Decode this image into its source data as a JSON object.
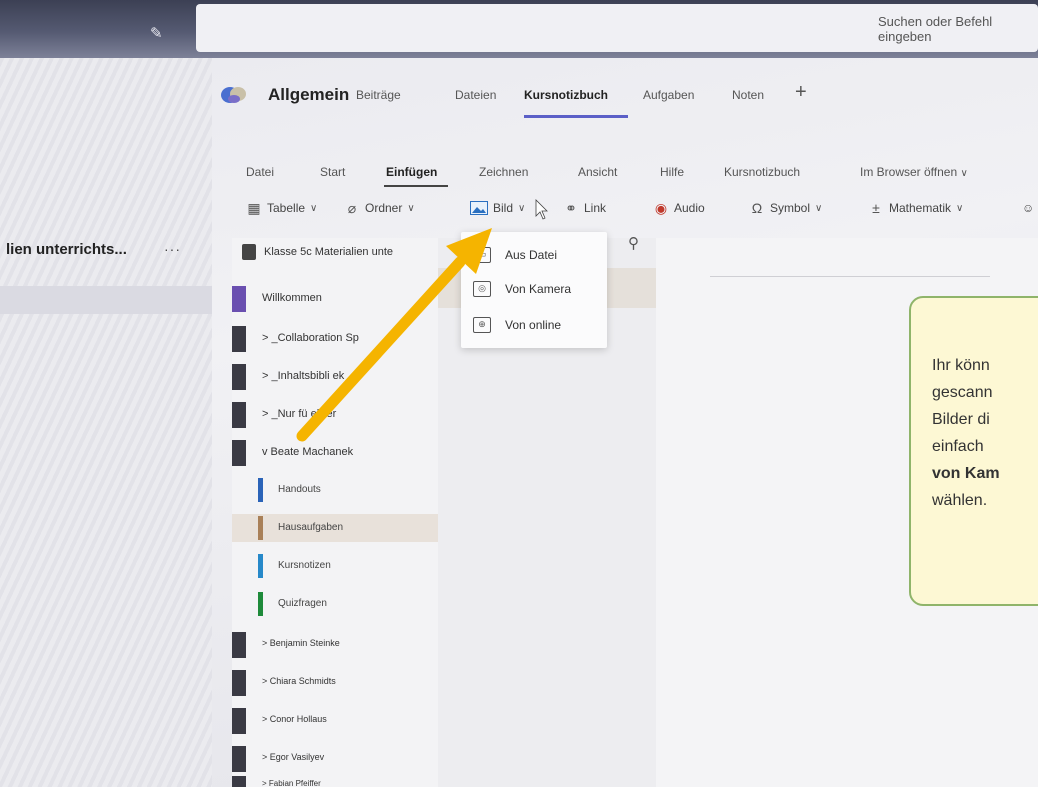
{
  "topbar": {
    "search_placeholder": "Suchen oder Befehl eingeben"
  },
  "rail": {
    "team_title": "lien unterrichts...",
    "more": "···"
  },
  "channel": {
    "name": "Allgemein",
    "tabs": [
      "Beiträge",
      "Dateien",
      "Kursnotizbuch",
      "Aufgaben",
      "Noten"
    ],
    "active_tab": "Kursnotizbuch",
    "add_tab": "+"
  },
  "ribbon": {
    "tabs": [
      "Datei",
      "Start",
      "Einfügen",
      "Zeichnen",
      "Ansicht",
      "Hilfe",
      "Kursnotizbuch",
      "Im Browser öffnen"
    ],
    "active_tab": "Einfügen",
    "buttons": {
      "table": "Tabelle",
      "folder": "Ordner",
      "image": "Bild",
      "link": "Link",
      "audio": "Audio",
      "symbol": "Symbol",
      "math": "Mathematik"
    }
  },
  "notebook": {
    "name": "Klasse 5c Materialien unte",
    "welcome": "Willkommen",
    "sections": [
      {
        "label": "> _Collaboration Sp",
        "color": "#3a3a44"
      },
      {
        "label": "> _Inhaltsbibli    ek",
        "color": "#3a3a44"
      },
      {
        "label": "> _Nur fü   ehrer",
        "color": "#3a3a44"
      },
      {
        "label": "v Beate Machanek",
        "color": "#3a3a44"
      }
    ],
    "pages": [
      {
        "label": "Handouts",
        "color": "#2a63b8"
      },
      {
        "label": "Hausaufgaben",
        "color": "#a98058"
      },
      {
        "label": "Kursnotizen",
        "color": "#2688c9"
      },
      {
        "label": "Quizfragen",
        "color": "#1e8a3a"
      }
    ],
    "students": [
      "> Benjamin Steinke",
      "> Chiara Schmidts",
      "> Conor Hollaus",
      "> Egor Vasilyev",
      "> Fabian Pfeiffer"
    ]
  },
  "dropdown": {
    "items": [
      "Aus Datei",
      "Von Kamera",
      "Von online"
    ]
  },
  "callout": {
    "lines": [
      "Ihr könn",
      "gescann",
      "Bilder di",
      "einfach",
      "von Kam",
      "wählen."
    ]
  },
  "colors": {
    "accent": "#5b5fc7",
    "arrow": "#f5b400",
    "callout_bg": "#fdf8d4",
    "callout_border": "#8fb46a"
  }
}
